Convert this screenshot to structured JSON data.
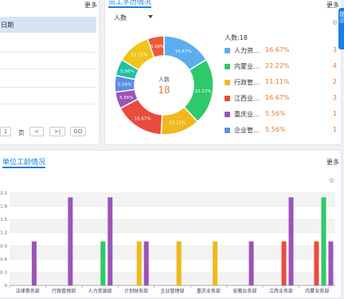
{
  "left_panel": {
    "more": "更多",
    "column_header": "日期",
    "pagination": {
      "page_value": "1",
      "page_suffix": "页",
      "prev": "<",
      "next": ">",
      "last": ">|",
      "go": "GO"
    }
  },
  "donut_panel": {
    "title": "员工学历情况",
    "more": "更多",
    "selector": "人数",
    "center_label": "人数",
    "center_value": "18",
    "legend_total": "人数:18",
    "legend": [
      {
        "name": "人力资...",
        "percent": "16.67%",
        "count": "3",
        "color": "#5aaeef"
      },
      {
        "name": "内蒙业...",
        "percent": "22.22%",
        "count": "4",
        "color": "#2ec96a"
      },
      {
        "name": "行政管...",
        "percent": "11.11%",
        "count": "2",
        "color": "#f0b81c"
      },
      {
        "name": "江西业...",
        "percent": "16.67%",
        "count": "3",
        "color": "#e94b3c"
      },
      {
        "name": "重庆业...",
        "percent": "5.56%",
        "count": "1",
        "color": "#9b54b8"
      },
      {
        "name": "企业管...",
        "percent": "5.56%",
        "count": "1",
        "color": "#5c8ee6"
      }
    ],
    "slice_labels": [
      "16.67%",
      "22.22%",
      "13.11%",
      "16.67%",
      "5.56%",
      "5.56%",
      "5.56%",
      "11.11%",
      "5.56%"
    ]
  },
  "bar_panel": {
    "title": "单位工龄情况",
    "more": "更多",
    "side_tab": "提示"
  },
  "chart_data": [
    {
      "type": "pie",
      "title": "",
      "center_text": "人数 18",
      "slices": [
        {
          "label": "16.67%",
          "value": 16.67,
          "color": "#5aaeef"
        },
        {
          "label": "22.22%",
          "value": 22.22,
          "color": "#2ec96a"
        },
        {
          "label": "13.11%",
          "value": 13.11,
          "color": "#f0b81c"
        },
        {
          "label": "16.67%",
          "value": 16.67,
          "color": "#e94b3c"
        },
        {
          "label": "5.56%",
          "value": 5.56,
          "color": "#9b54b8"
        },
        {
          "label": "5.56%",
          "value": 5.56,
          "color": "#5c8ee6"
        },
        {
          "label": "5.56%",
          "value": 5.56,
          "color": "#1fc1a7"
        },
        {
          "label": "11.11%",
          "value": 11.11,
          "color": "#f0c419"
        },
        {
          "label": "5.56%",
          "value": 5.56,
          "color": "#ea5b3a"
        }
      ]
    },
    {
      "type": "bar",
      "title": "单位工龄情况",
      "xlabel": "",
      "ylabel": "",
      "ylim": [
        0,
        2.1
      ],
      "y_ticks": [
        "0",
        "0.3",
        "0.6",
        "0.9",
        "1.2",
        "1.5",
        "1.8",
        "2.1"
      ],
      "categories": [
        "法律事务部",
        "行政管理部",
        "人力资源部",
        "计划财务部",
        "企业管理部",
        "重庆业务部",
        "安徽业务部",
        "江西业务部",
        "内蒙业务部"
      ],
      "series": [
        {
          "color": "#e94b3c",
          "values": [
            0,
            0,
            0,
            0,
            0,
            0,
            0,
            1,
            1
          ]
        },
        {
          "color": "#2ec96a",
          "values": [
            0,
            0,
            1,
            0,
            0,
            0,
            0,
            0,
            2
          ]
        },
        {
          "color": "#f0b81c",
          "values": [
            0,
            0,
            0,
            1,
            1,
            1,
            0,
            0,
            0
          ]
        },
        {
          "color": "#9b54b8",
          "values": [
            1,
            2,
            2,
            1,
            0,
            0,
            1,
            2,
            1
          ]
        }
      ]
    }
  ]
}
